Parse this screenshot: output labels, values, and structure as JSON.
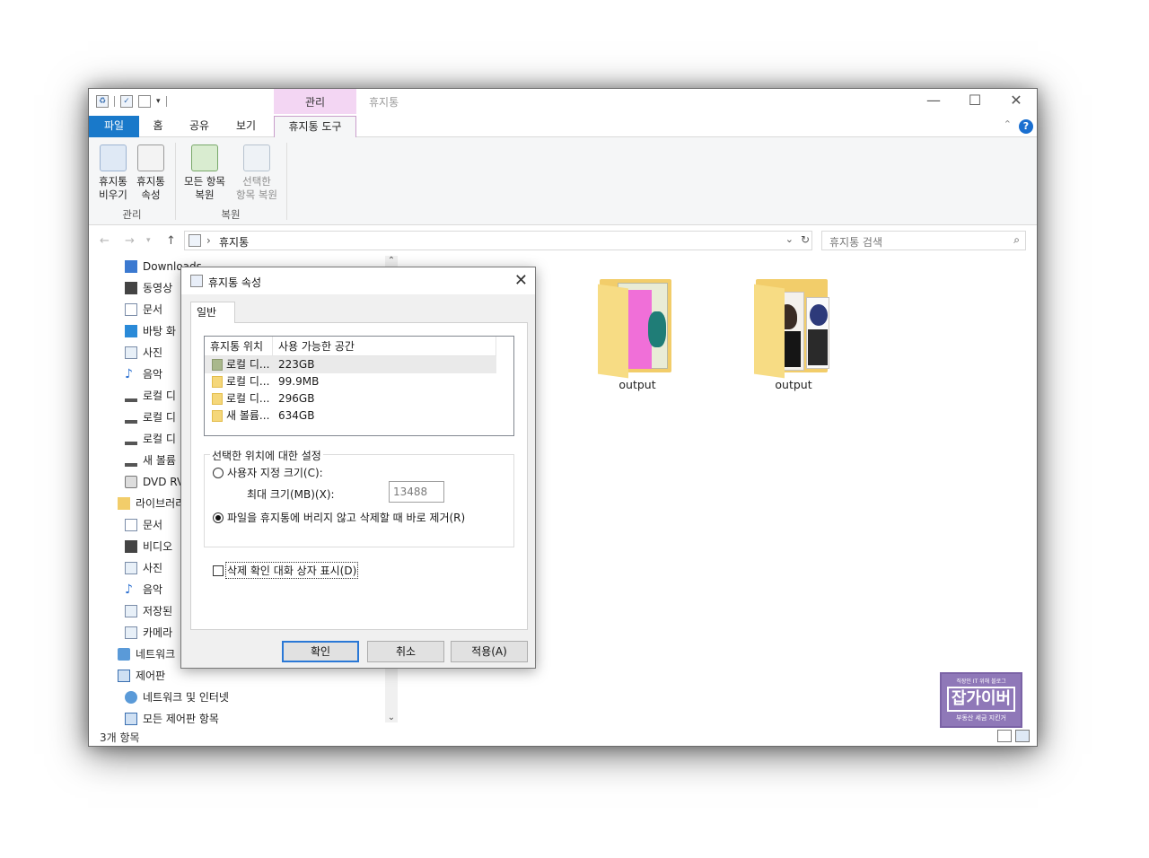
{
  "window": {
    "title": "휴지통",
    "context_tab_header": "관리"
  },
  "ribbon_tabs": {
    "file": "파일",
    "home": "홈",
    "share": "공유",
    "view": "보기",
    "recycle_tools": "휴지통 도구"
  },
  "ribbon": {
    "empty_bin": [
      "휴지통",
      "비우기"
    ],
    "bin_properties": [
      "휴지통",
      "속성"
    ],
    "group_manage": "관리",
    "restore_all": [
      "모든 항목",
      "복원"
    ],
    "restore_selected": [
      "선택한",
      "항목 복원"
    ],
    "group_restore": "복원"
  },
  "address": {
    "path": "휴지통",
    "search_placeholder": "휴지통 검색"
  },
  "nav": {
    "items": [
      "Downloads",
      "동영상",
      "문서",
      "바탕 화",
      "사진",
      "음악",
      "로컬 디",
      "로컬 디",
      "로컬 디",
      "새 볼륨",
      "DVD RV",
      "라이브러리",
      "문서",
      "비디오",
      "사진",
      "음악",
      "저장된",
      "카메라",
      "네트워크",
      "제어판",
      "네트워크 및 인터넷",
      "모든 제어판 항목"
    ]
  },
  "files": [
    {
      "label": "output"
    },
    {
      "label": "output"
    }
  ],
  "status": {
    "count": "3개 항목"
  },
  "watermark": {
    "top": "직장인 IT 위해 블로그",
    "main": "잡가이버",
    "bottom": "부동산 세금 지킨거"
  },
  "dialog": {
    "title": "휴지통 속성",
    "tab": "일반",
    "list_headers": {
      "location": "휴지통 위치",
      "space": "사용 가능한 공간"
    },
    "list_rows": [
      {
        "name": "로컬 디...",
        "space": "223GB"
      },
      {
        "name": "로컬 디...",
        "space": "99.9MB"
      },
      {
        "name": "로컬 디...",
        "space": "296GB"
      },
      {
        "name": "새 볼륨...",
        "space": "634GB"
      }
    ],
    "group_label": "선택한 위치에 대한 설정",
    "custom_size": "사용자 지정 크기(C):",
    "max_size_label": "최대 크기(MB)(X):",
    "max_size_value": "13488",
    "delete_immediately": "파일을 휴지통에 버리지 않고 삭제할 때 바로 제거(R)",
    "confirm_dialog": "삭제 확인 대화 상자 표시(D)",
    "ok": "확인",
    "cancel": "취소",
    "apply": "적용(A)"
  }
}
